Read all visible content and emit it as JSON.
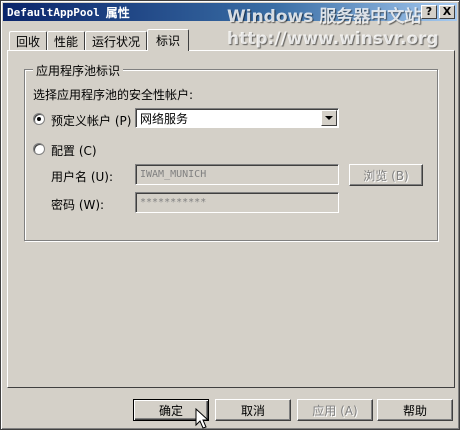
{
  "window": {
    "title_app": "DefaultAppPool",
    "title_suffix": "属性",
    "help_button": "?",
    "close_button": "X",
    "watermark_line1": "Windows 服务器中文站",
    "watermark_line2": "http://www.winsvr.org"
  },
  "tabs": [
    {
      "label": "回收",
      "active": false
    },
    {
      "label": "性能",
      "active": false
    },
    {
      "label": "运行状况",
      "active": false
    },
    {
      "label": "标识",
      "active": true
    }
  ],
  "identity": {
    "group_title": "应用程序池标识",
    "instruction": "选择应用程序池的安全性帐户:",
    "predefined_label": "预定义帐户 (P)",
    "predefined_selected": true,
    "predefined_value": "网络服务",
    "configurable_label": "配置 (C)",
    "configurable_selected": false,
    "username_label": "用户名 (U):",
    "username_value": "IWAM_MUNICH",
    "browse_button": "浏览 (B)",
    "password_label": "密码 (W):",
    "password_value": "***********"
  },
  "footer": {
    "ok": "确定",
    "cancel": "取消",
    "apply": "应用 (A)",
    "help": "帮助"
  }
}
